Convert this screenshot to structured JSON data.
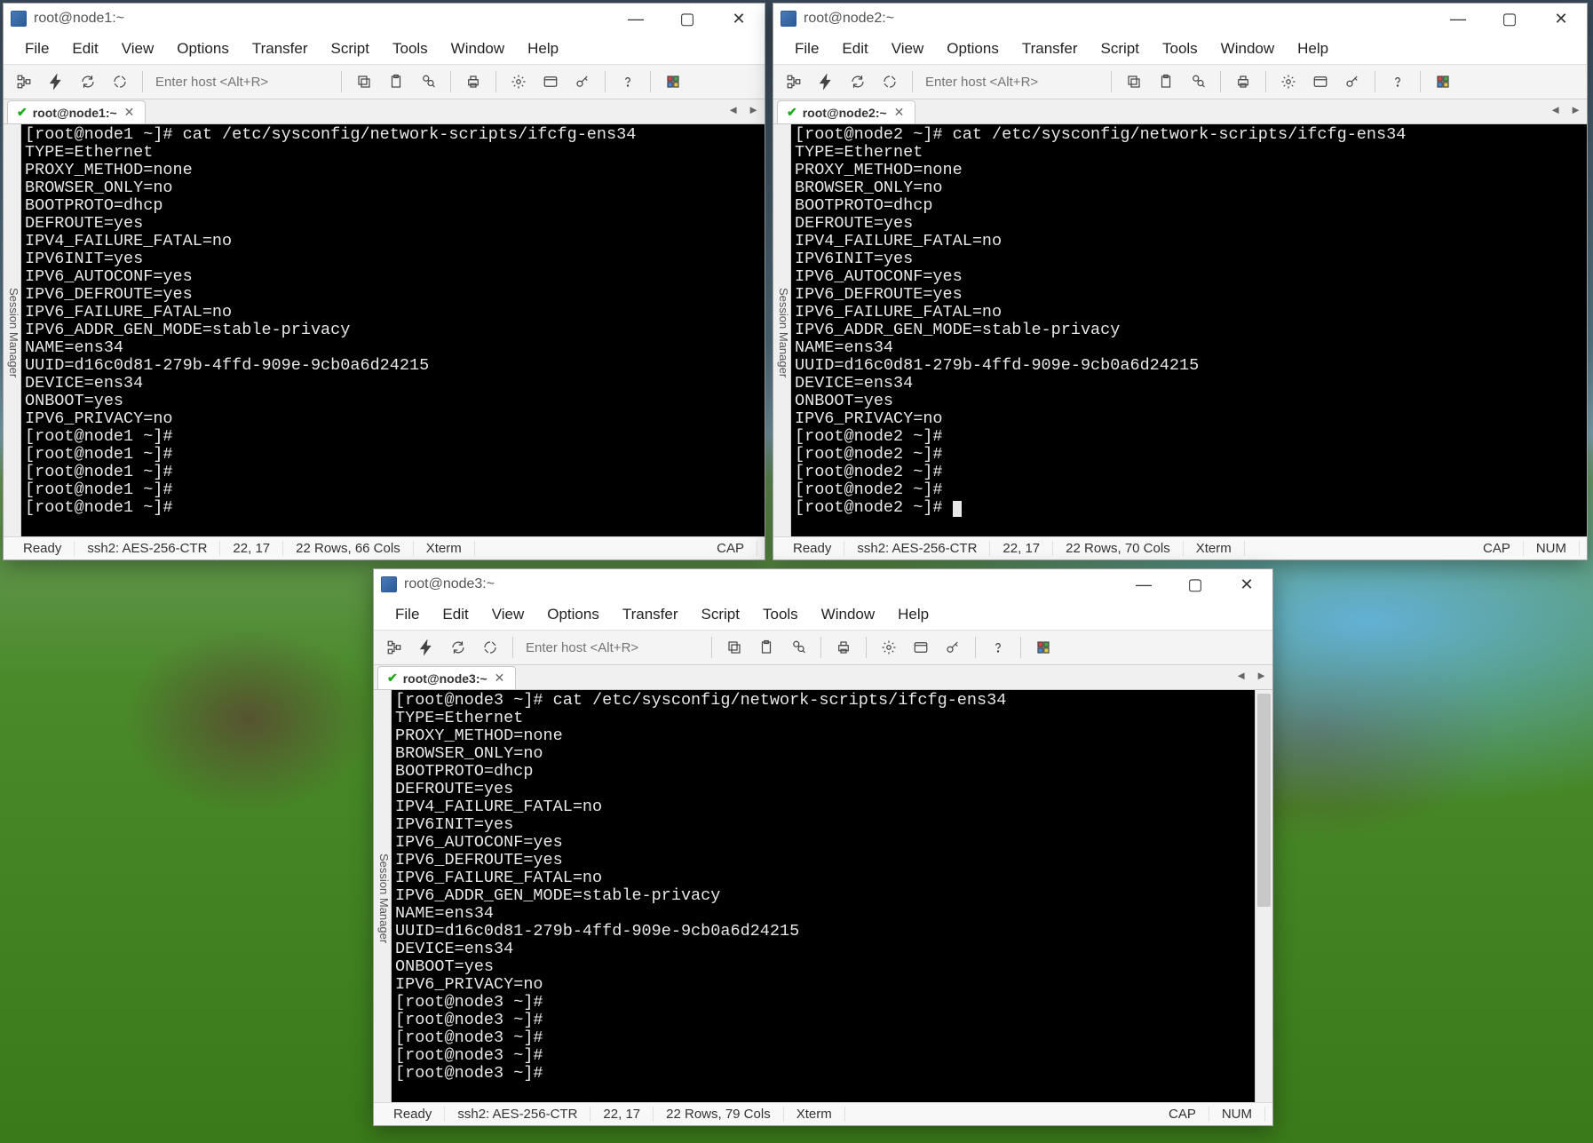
{
  "menus": [
    "File",
    "Edit",
    "View",
    "Options",
    "Transfer",
    "Script",
    "Tools",
    "Window",
    "Help"
  ],
  "host_placeholder": "Enter host <Alt+R>",
  "session_manager_label": "Session Manager",
  "status": {
    "ready": "Ready",
    "cipher": "ssh2: AES-256-CTR",
    "pos": "22,  17",
    "xterm": "Xterm",
    "cap": "CAP",
    "num": "NUM"
  },
  "windows": [
    {
      "id": "win1",
      "title": "root@node1:~",
      "tab_label": "root@node1:~",
      "rowcols": "22 Rows, 66 Cols",
      "show_num": false,
      "show_scrollbar": false,
      "cursor": false,
      "lines": [
        "[root@node1 ~]# cat /etc/sysconfig/network-scripts/ifcfg-ens34",
        "TYPE=Ethernet",
        "PROXY_METHOD=none",
        "BROWSER_ONLY=no",
        "BOOTPROTO=dhcp",
        "DEFROUTE=yes",
        "IPV4_FAILURE_FATAL=no",
        "IPV6INIT=yes",
        "IPV6_AUTOCONF=yes",
        "IPV6_DEFROUTE=yes",
        "IPV6_FAILURE_FATAL=no",
        "IPV6_ADDR_GEN_MODE=stable-privacy",
        "NAME=ens34",
        "UUID=d16c0d81-279b-4ffd-909e-9cb0a6d24215",
        "DEVICE=ens34",
        "ONBOOT=yes",
        "IPV6_PRIVACY=no",
        "[root@node1 ~]#",
        "[root@node1 ~]#",
        "[root@node1 ~]#",
        "[root@node1 ~]#",
        "[root@node1 ~]#"
      ]
    },
    {
      "id": "win2",
      "title": "root@node2:~",
      "tab_label": "root@node2:~",
      "rowcols": "22 Rows, 70 Cols",
      "show_num": true,
      "show_scrollbar": false,
      "cursor": true,
      "lines": [
        "[root@node2 ~]# cat /etc/sysconfig/network-scripts/ifcfg-ens34",
        "TYPE=Ethernet",
        "PROXY_METHOD=none",
        "BROWSER_ONLY=no",
        "BOOTPROTO=dhcp",
        "DEFROUTE=yes",
        "IPV4_FAILURE_FATAL=no",
        "IPV6INIT=yes",
        "IPV6_AUTOCONF=yes",
        "IPV6_DEFROUTE=yes",
        "IPV6_FAILURE_FATAL=no",
        "IPV6_ADDR_GEN_MODE=stable-privacy",
        "NAME=ens34",
        "UUID=d16c0d81-279b-4ffd-909e-9cb0a6d24215",
        "DEVICE=ens34",
        "ONBOOT=yes",
        "IPV6_PRIVACY=no",
        "[root@node2 ~]#",
        "[root@node2 ~]#",
        "[root@node2 ~]#",
        "[root@node2 ~]#",
        "[root@node2 ~]# "
      ]
    },
    {
      "id": "win3",
      "title": "root@node3:~",
      "tab_label": "root@node3:~",
      "rowcols": "22 Rows, 79 Cols",
      "show_num": true,
      "show_scrollbar": true,
      "cursor": false,
      "lines": [
        "[root@node3 ~]# cat /etc/sysconfig/network-scripts/ifcfg-ens34",
        "TYPE=Ethernet",
        "PROXY_METHOD=none",
        "BROWSER_ONLY=no",
        "BOOTPROTO=dhcp",
        "DEFROUTE=yes",
        "IPV4_FAILURE_FATAL=no",
        "IPV6INIT=yes",
        "IPV6_AUTOCONF=yes",
        "IPV6_DEFROUTE=yes",
        "IPV6_FAILURE_FATAL=no",
        "IPV6_ADDR_GEN_MODE=stable-privacy",
        "NAME=ens34",
        "UUID=d16c0d81-279b-4ffd-909e-9cb0a6d24215",
        "DEVICE=ens34",
        "ONBOOT=yes",
        "IPV6_PRIVACY=no",
        "[root@node3 ~]#",
        "[root@node3 ~]#",
        "[root@node3 ~]#",
        "[root@node3 ~]#",
        "[root@node3 ~]#"
      ]
    }
  ],
  "toolbar_icons": [
    {
      "name": "session-tree-icon"
    },
    {
      "name": "quick-connect-icon"
    },
    {
      "name": "reconnect-icon"
    },
    {
      "name": "disconnect-icon"
    },
    {
      "name": "sep"
    },
    {
      "name": "host-input"
    },
    {
      "name": "sep"
    },
    {
      "name": "copy-icon"
    },
    {
      "name": "paste-icon"
    },
    {
      "name": "find-icon"
    },
    {
      "name": "sep"
    },
    {
      "name": "print-icon"
    },
    {
      "name": "sep"
    },
    {
      "name": "settings-icon"
    },
    {
      "name": "session-options-icon"
    },
    {
      "name": "key-icon"
    },
    {
      "name": "sep"
    },
    {
      "name": "help-icon"
    },
    {
      "name": "sep"
    },
    {
      "name": "color-toggle-icon"
    }
  ]
}
